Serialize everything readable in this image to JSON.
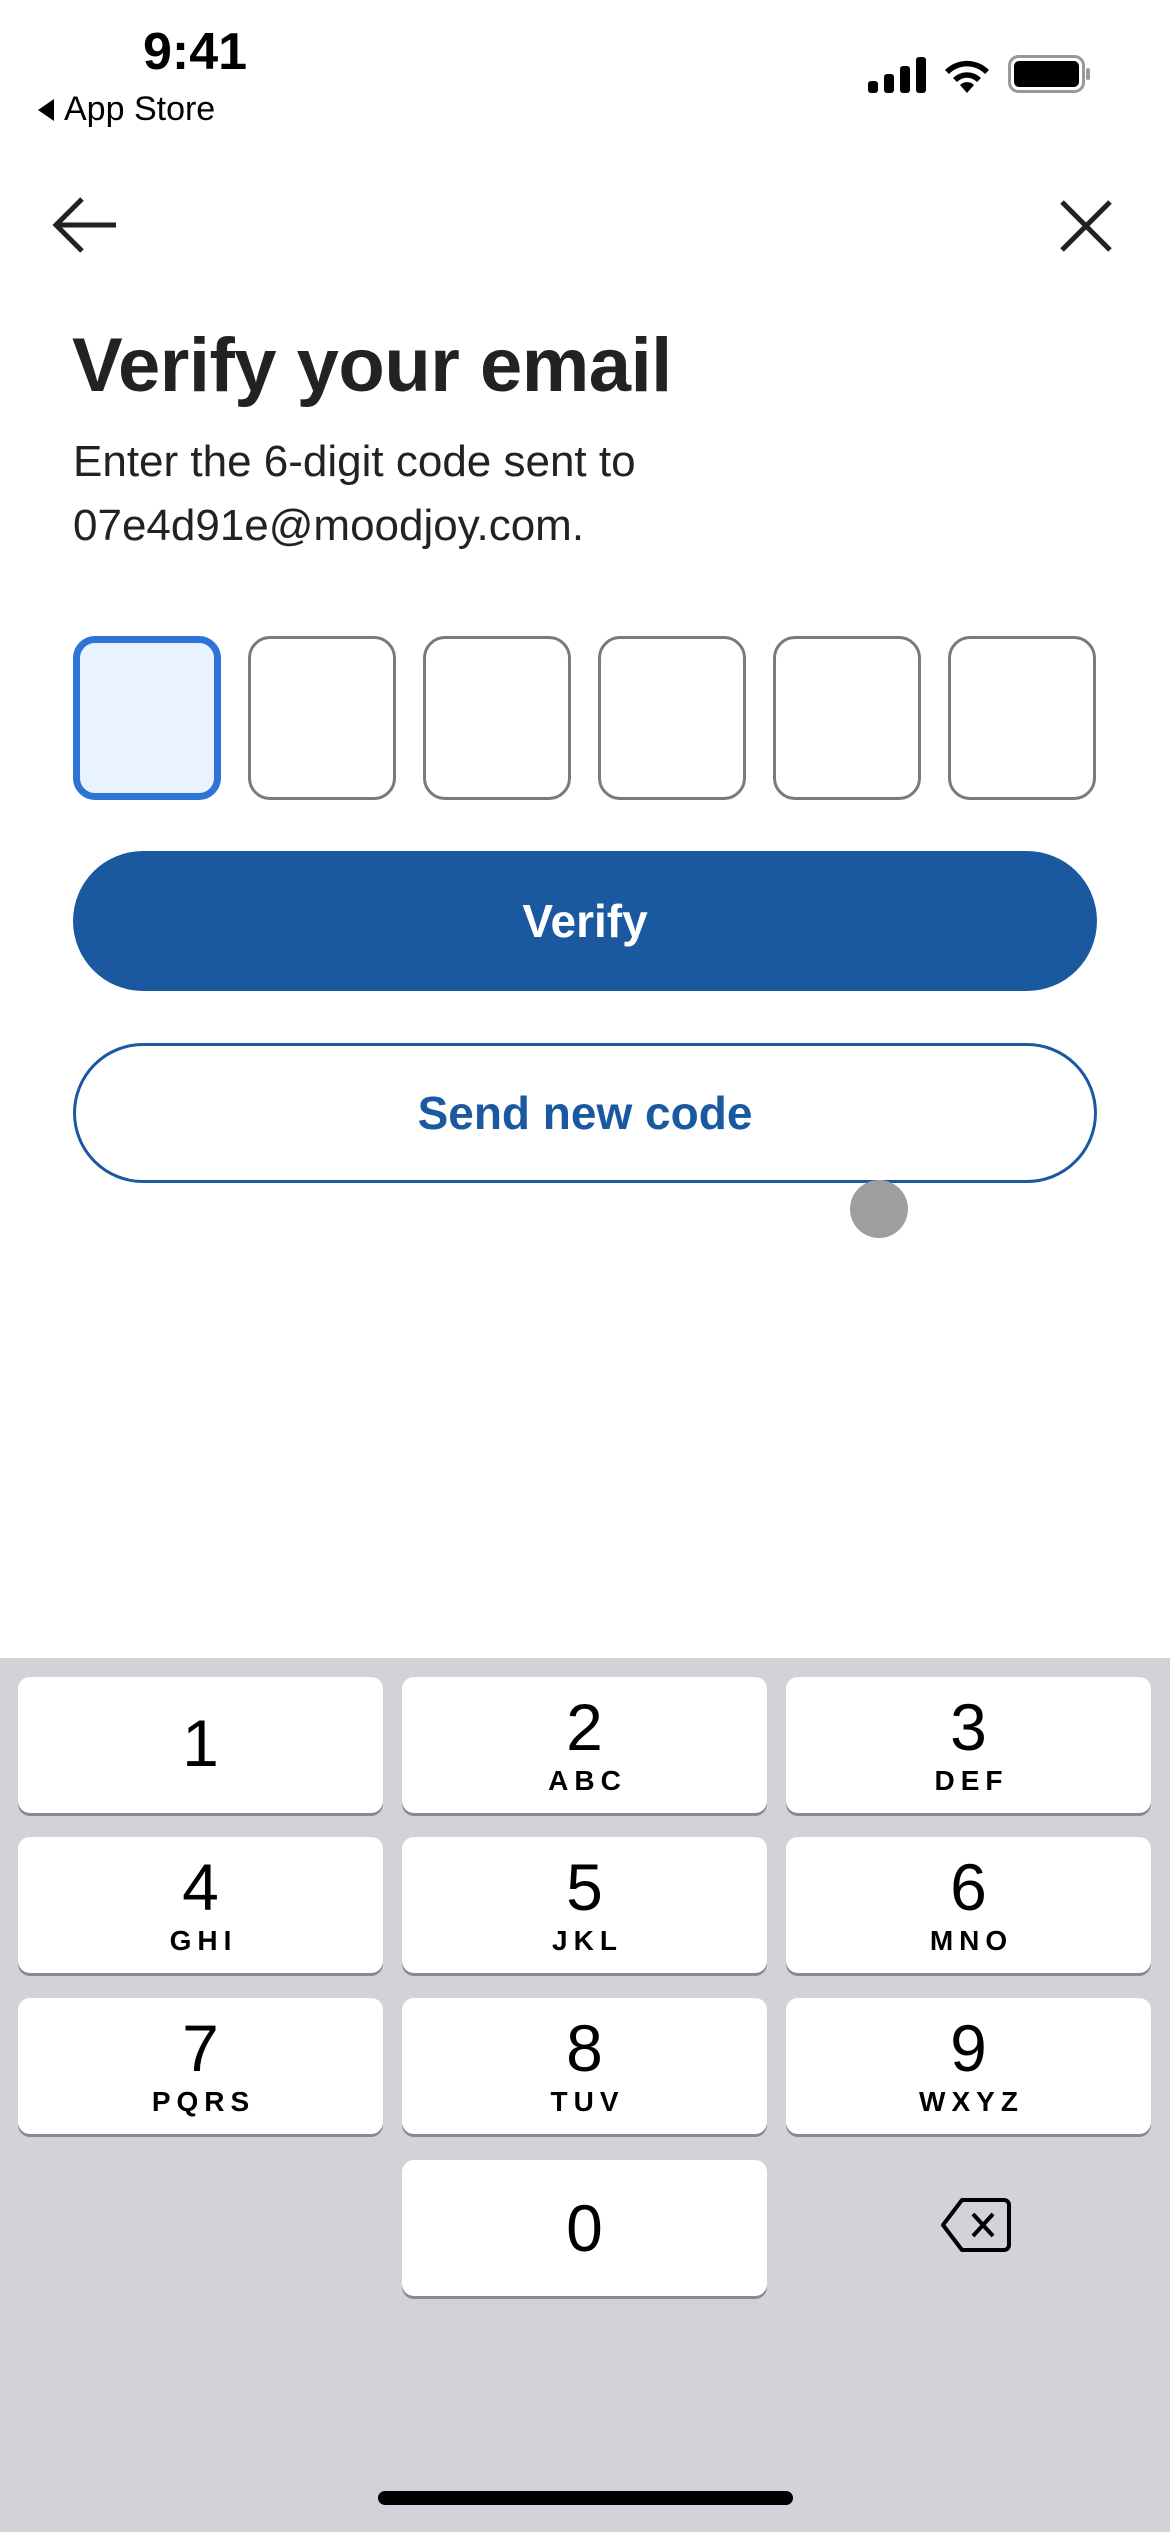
{
  "status_bar": {
    "time": "9:41",
    "back_app": "App Store"
  },
  "nav": {
    "back_icon": "arrow-left-icon",
    "close_icon": "close-icon"
  },
  "title": "Verify your email",
  "subtitle": "Enter the 6-digit code sent to 07e4d91e@moodjoy.com.",
  "code": {
    "length": 6,
    "values": [
      "",
      "",
      "",
      "",
      "",
      ""
    ],
    "active_index": 0
  },
  "buttons": {
    "verify": "Verify",
    "resend": "Send new code"
  },
  "colors": {
    "primary": "#1a58a0",
    "focus": "#2d74d6",
    "keyboard_bg": "#d1d3d9"
  },
  "keyboard": {
    "keys": [
      {
        "n": "1",
        "l": ""
      },
      {
        "n": "2",
        "l": "ABC"
      },
      {
        "n": "3",
        "l": "DEF"
      },
      {
        "n": "4",
        "l": "GHI"
      },
      {
        "n": "5",
        "l": "JKL"
      },
      {
        "n": "6",
        "l": "MNO"
      },
      {
        "n": "7",
        "l": "PQRS"
      },
      {
        "n": "8",
        "l": "TUV"
      },
      {
        "n": "9",
        "l": "WXYZ"
      },
      {
        "n": "0",
        "l": ""
      }
    ],
    "delete_icon": "backspace-icon"
  }
}
